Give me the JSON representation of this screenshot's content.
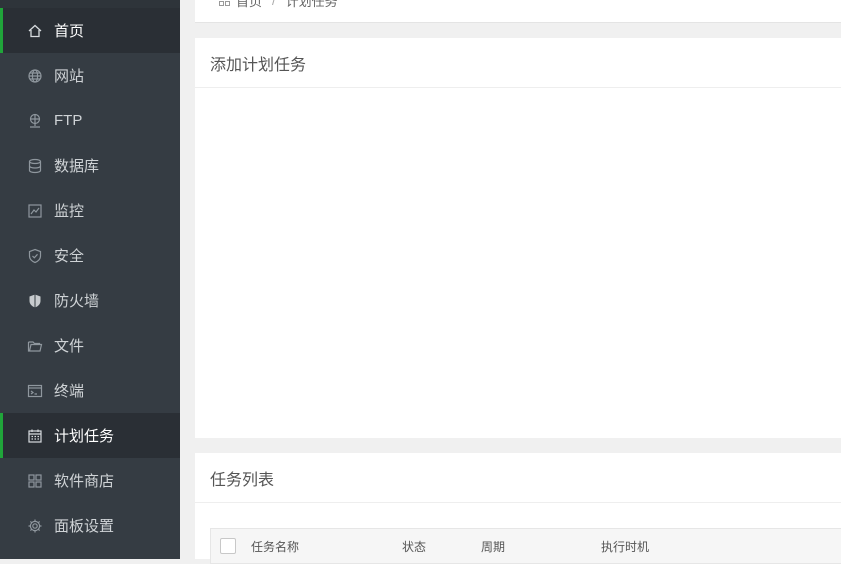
{
  "sidebar": {
    "items": [
      {
        "label": "首页",
        "icon": "home-icon",
        "active": true
      },
      {
        "label": "网站",
        "icon": "globe-icon",
        "active": false
      },
      {
        "label": "FTP",
        "icon": "ftp-icon",
        "active": false
      },
      {
        "label": "数据库",
        "icon": "database-icon",
        "active": false
      },
      {
        "label": "监控",
        "icon": "monitor-chart-icon",
        "active": false
      },
      {
        "label": "安全",
        "icon": "shield-icon",
        "active": false
      },
      {
        "label": "防火墙",
        "icon": "firewall-shield-icon",
        "active": false
      },
      {
        "label": "文件",
        "icon": "folder-icon",
        "active": false
      },
      {
        "label": "终端",
        "icon": "terminal-icon",
        "active": false
      },
      {
        "label": "计划任务",
        "icon": "calendar-icon",
        "active": true
      },
      {
        "label": "软件商店",
        "icon": "grid-apps-icon",
        "active": false
      },
      {
        "label": "面板设置",
        "icon": "gear-icon",
        "active": false
      }
    ]
  },
  "breadcrumb": {
    "home": "首页",
    "separator": "/",
    "current": "计划任务"
  },
  "add_panel": {
    "title": "添加计划任务"
  },
  "list_panel": {
    "title": "任务列表",
    "columns": [
      "任务名称",
      "状态",
      "周期",
      "执行时机"
    ]
  },
  "colors": {
    "sidebar_bg": "#353c43",
    "accent": "#20a53a",
    "page_bg": "#f0f0f0"
  }
}
